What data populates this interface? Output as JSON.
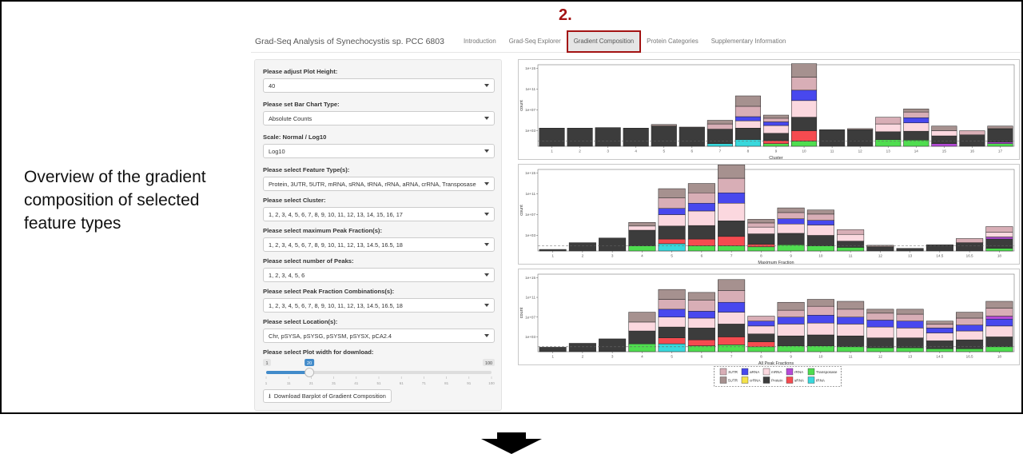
{
  "caption": "Overview  of the gradient composition of selected feature types",
  "step_number": "2.",
  "app": {
    "title": "Grad-Seq Analysis of Synechocystis sp. PCC 6803",
    "tabs": [
      {
        "label": "Introduction",
        "active": false
      },
      {
        "label": "Grad-Seq Explorer",
        "active": false
      },
      {
        "label": "Gradient Composition",
        "active": true
      },
      {
        "label": "Protein Categories",
        "active": false
      },
      {
        "label": "Supplementary Information",
        "active": false
      }
    ]
  },
  "sidebar": {
    "fields": [
      {
        "label": "Please adjust Plot Height:",
        "value": "40"
      },
      {
        "label": "Please set Bar Chart Type:",
        "value": "Absolute Counts"
      },
      {
        "label": "Scale: Normal / Log10",
        "value": "Log10"
      },
      {
        "label": "Please select Feature Type(s):",
        "value": "Protein, 3UTR, 5UTR, mRNA, sRNA, tRNA, rRNA, aRNA, crRNA, Transposase"
      },
      {
        "label": "Please select Cluster:",
        "value": "1, 2, 3, 4, 5, 6, 7, 8, 9, 10, 11, 12, 13, 14, 15, 16, 17"
      },
      {
        "label": "Please select maximum Peak Fraction(s):",
        "value": "1, 2, 3, 4, 5, 6, 7, 8, 9, 10, 11, 12, 13, 14.5, 16.5, 18"
      },
      {
        "label": "Please select number of Peaks:",
        "value": "1, 2, 3, 4, 5, 6"
      },
      {
        "label": "Please select Peak Fraction Combinations(s):",
        "value": "1, 2, 3, 4, 5, 6, 7, 8, 9, 10, 11, 12, 13, 14.5, 16.5, 18"
      },
      {
        "label": "Please select Location(s):",
        "value": "Chr, pSYSA, pSYSG, pSYSM, pSYSX, pCA2.4"
      }
    ],
    "slider": {
      "label": "Please select Plot width for download:",
      "min": 1,
      "max": 100,
      "value": 20,
      "min_label": "1",
      "max_label": "100",
      "value_label": "20",
      "ticks": [
        "1",
        "11",
        "21",
        "31",
        "41",
        "51",
        "61",
        "71",
        "81",
        "91",
        "100"
      ]
    },
    "download_button": "Download Barplot of Gradient Composition"
  },
  "colors": {
    "3UTR": "#d8aeb6",
    "5UTR": "#a6918f",
    "aRNA": "#4848ee",
    "crRNA": "#f4e24a",
    "mRNA": "#fbd8df",
    "Protein": "#3c3c3c",
    "rRNA": "#b54bd8",
    "sRNA": "#f54b50",
    "Transposase": "#4fdd4f",
    "tRNA": "#38d8dc"
  },
  "legend": [
    {
      "name": "3UTR",
      "color": "#d8aeb6"
    },
    {
      "name": "5UTR",
      "color": "#a6918f"
    },
    {
      "name": "aRNA",
      "color": "#4848ee"
    },
    {
      "name": "crRNA",
      "color": "#f4e24a"
    },
    {
      "name": "mRNA",
      "color": "#fbd8df"
    },
    {
      "name": "Protein",
      "color": "#3c3c3c"
    },
    {
      "name": "rRNA",
      "color": "#b54bd8"
    },
    {
      "name": "sRNA",
      "color": "#f54b50"
    },
    {
      "name": "Transposase",
      "color": "#4fdd4f"
    },
    {
      "name": "tRNA",
      "color": "#38d8dc"
    }
  ],
  "chart_data": [
    {
      "type": "bar",
      "xlabel": "Cluster",
      "ylabel": "count",
      "y_scale": "log10",
      "y_ticks": [
        "1e+03",
        "1e+07",
        "1e+11",
        "1e+15"
      ],
      "categories": [
        "1",
        "2",
        "3",
        "4",
        "5",
        "6",
        "7",
        "8",
        "9",
        "10",
        "11",
        "12",
        "13",
        "14",
        "15",
        "16",
        "17"
      ],
      "stacks": [
        [
          [
            "Protein",
            3.5
          ]
        ],
        [
          [
            "Protein",
            3.5
          ]
        ],
        [
          [
            "Protein",
            3.6
          ]
        ],
        [
          [
            "Protein",
            3.5
          ]
        ],
        [
          [
            "Protein",
            3.9
          ],
          [
            "5UTR",
            0.3
          ]
        ],
        [
          [
            "Protein",
            3.6
          ],
          [
            "5UTR",
            0.1
          ]
        ],
        [
          [
            "tRNA",
            0.5
          ],
          [
            "Protein",
            2.8
          ],
          [
            "3UTR",
            1.0
          ],
          [
            "5UTR",
            0.7
          ]
        ],
        [
          [
            "tRNA",
            1.3
          ],
          [
            "Protein",
            2.2
          ],
          [
            "mRNA",
            1.4
          ],
          [
            "aRNA",
            0.8
          ],
          [
            "3UTR",
            2.0
          ],
          [
            "5UTR",
            2.0
          ]
        ],
        [
          [
            "Transposase",
            0.5
          ],
          [
            "sRNA",
            0.6
          ],
          [
            "Protein",
            1.4
          ],
          [
            "mRNA",
            1.5
          ],
          [
            "aRNA",
            0.7
          ],
          [
            "3UTR",
            0.7
          ],
          [
            "5UTR",
            0.6
          ]
        ],
        [
          [
            "Transposase",
            1.0
          ],
          [
            "sRNA",
            2.0
          ],
          [
            "Protein",
            2.6
          ],
          [
            "mRNA",
            3.2
          ],
          [
            "aRNA",
            2.0
          ],
          [
            "3UTR",
            2.5
          ],
          [
            "5UTR",
            2.6
          ]
        ],
        [
          [
            "Protein",
            3.2
          ]
        ],
        [
          [
            "Protein",
            3.2
          ],
          [
            "5UTR",
            0.2
          ]
        ],
        [
          [
            "Transposase",
            1.3
          ],
          [
            "Protein",
            1.5
          ],
          [
            "mRNA",
            1.5
          ],
          [
            "3UTR",
            1.3
          ]
        ],
        [
          [
            "Transposase",
            1.2
          ],
          [
            "Protein",
            1.7
          ],
          [
            "mRNA",
            1.6
          ],
          [
            "aRNA",
            1.0
          ],
          [
            "3UTR",
            1.1
          ],
          [
            "5UTR",
            0.6
          ]
        ],
        [
          [
            "rRNA",
            0.5
          ],
          [
            "Protein",
            1.5
          ],
          [
            "mRNA",
            1.0
          ],
          [
            "5UTR",
            0.9
          ]
        ],
        [
          [
            "Protein",
            2.2
          ],
          [
            "3UTR",
            0.8
          ]
        ],
        [
          [
            "Transposase",
            0.5
          ],
          [
            "rRNA",
            0.3
          ],
          [
            "Protein",
            2.6
          ],
          [
            "5UTR",
            0.5
          ]
        ]
      ]
    },
    {
      "type": "bar",
      "xlabel": "Maximum Fraction",
      "ylabel": "count",
      "y_scale": "log10",
      "y_ticks": [
        "1e+03",
        "1e+07",
        "1e+11",
        "1e+15"
      ],
      "categories": [
        "1",
        "2",
        "3",
        "4",
        "5",
        "6",
        "7",
        "8",
        "9",
        "10",
        "11",
        "12",
        "13",
        "14.5",
        "16.5",
        "18"
      ],
      "stacks": [
        [
          [
            "Protein",
            0.3
          ]
        ],
        [
          [
            "Protein",
            1.6
          ]
        ],
        [
          [
            "Protein",
            2.5
          ]
        ],
        [
          [
            "Transposase",
            1.0
          ],
          [
            "Protein",
            3.0
          ],
          [
            "mRNA",
            0.8
          ],
          [
            "5UTR",
            0.7
          ]
        ],
        [
          [
            "tRNA",
            1.4
          ],
          [
            "sRNA",
            0.9
          ],
          [
            "Protein",
            2.5
          ],
          [
            "mRNA",
            2.2
          ],
          [
            "aRNA",
            1.2
          ],
          [
            "3UTR",
            2.0
          ],
          [
            "5UTR",
            1.8
          ]
        ],
        [
          [
            "Transposase",
            1.0
          ],
          [
            "sRNA",
            1.3
          ],
          [
            "Protein",
            2.6
          ],
          [
            "mRNA",
            2.8
          ],
          [
            "aRNA",
            1.5
          ],
          [
            "3UTR",
            2.0
          ],
          [
            "5UTR",
            1.8
          ]
        ],
        [
          [
            "Transposase",
            1.0
          ],
          [
            "sRNA",
            1.8
          ],
          [
            "Protein",
            3.0
          ],
          [
            "mRNA",
            3.4
          ],
          [
            "aRNA",
            2.0
          ],
          [
            "3UTR",
            2.8
          ],
          [
            "5UTR",
            2.6
          ]
        ],
        [
          [
            "Transposase",
            0.8
          ],
          [
            "sRNA",
            0.5
          ],
          [
            "Protein",
            2.0
          ],
          [
            "mRNA",
            1.3
          ],
          [
            "3UTR",
            0.8
          ],
          [
            "5UTR",
            0.7
          ]
        ],
        [
          [
            "Transposase",
            1.2
          ],
          [
            "Protein",
            2.2
          ],
          [
            "mRNA",
            1.8
          ],
          [
            "aRNA",
            1.0
          ],
          [
            "3UTR",
            1.2
          ],
          [
            "5UTR",
            0.9
          ]
        ],
        [
          [
            "Transposase",
            1.0
          ],
          [
            "Protein",
            2.0
          ],
          [
            "mRNA",
            2.0
          ],
          [
            "aRNA",
            0.9
          ],
          [
            "3UTR",
            1.2
          ],
          [
            "5UTR",
            0.8
          ]
        ],
        [
          [
            "Transposase",
            0.7
          ],
          [
            "Protein",
            1.2
          ],
          [
            "mRNA",
            1.3
          ],
          [
            "3UTR",
            0.9
          ]
        ],
        [
          [
            "Protein",
            0.8
          ],
          [
            "5UTR",
            0.3
          ]
        ],
        [
          [
            "Protein",
            0.5
          ]
        ],
        [
          [
            "Protein",
            1.2
          ]
        ],
        [
          [
            "Protein",
            1.6
          ],
          [
            "3UTR",
            0.8
          ]
        ],
        [
          [
            "Transposase",
            0.5
          ],
          [
            "Protein",
            1.8
          ],
          [
            "rRNA",
            0.4
          ],
          [
            "mRNA",
            0.9
          ],
          [
            "3UTR",
            1.1
          ]
        ]
      ]
    },
    {
      "type": "bar",
      "xlabel": "All Peak Fractions",
      "ylabel": "count",
      "y_scale": "log10",
      "y_ticks": [
        "1e+03",
        "1e+07",
        "1e+11",
        "1e+15"
      ],
      "categories": [
        "1",
        "2",
        "3",
        "4",
        "5",
        "6",
        "7",
        "8",
        "9",
        "10",
        "11",
        "12",
        "13",
        "14.5",
        "16.5",
        "18"
      ],
      "stacks": [
        [
          [
            "Protein",
            0.9
          ]
        ],
        [
          [
            "Protein",
            1.7
          ]
        ],
        [
          [
            "Protein",
            2.6
          ]
        ],
        [
          [
            "Transposase",
            1.6
          ],
          [
            "Protein",
            2.6
          ],
          [
            "mRNA",
            1.8
          ],
          [
            "5UTR",
            2.0
          ]
        ],
        [
          [
            "tRNA",
            1.6
          ],
          [
            "sRNA",
            1.2
          ],
          [
            "Protein",
            2.2
          ],
          [
            "mRNA",
            2.0
          ],
          [
            "aRNA",
            1.6
          ],
          [
            "3UTR",
            2.0
          ],
          [
            "5UTR",
            2.0
          ]
        ],
        [
          [
            "Transposase",
            1.2
          ],
          [
            "sRNA",
            1.2
          ],
          [
            "Protein",
            2.4
          ],
          [
            "mRNA",
            2.0
          ],
          [
            "aRNA",
            1.4
          ],
          [
            "3UTR",
            2.2
          ],
          [
            "5UTR",
            1.6
          ]
        ],
        [
          [
            "Transposase",
            1.4
          ],
          [
            "sRNA",
            1.6
          ],
          [
            "Protein",
            2.6
          ],
          [
            "mRNA",
            2.4
          ],
          [
            "aRNA",
            2.0
          ],
          [
            "3UTR",
            2.4
          ],
          [
            "5UTR",
            2.2
          ]
        ],
        [
          [
            "Transposase",
            1.0
          ],
          [
            "sRNA",
            1.0
          ],
          [
            "Protein",
            1.6
          ],
          [
            "mRNA",
            1.6
          ],
          [
            "aRNA",
            1.0
          ],
          [
            "3UTR",
            1.0
          ]
        ],
        [
          [
            "Transposase",
            1.2
          ],
          [
            "Protein",
            2.0
          ],
          [
            "mRNA",
            2.4
          ],
          [
            "aRNA",
            1.4
          ],
          [
            "3UTR",
            1.4
          ],
          [
            "5UTR",
            1.6
          ]
        ],
        [
          [
            "Transposase",
            1.2
          ],
          [
            "Protein",
            2.2
          ],
          [
            "mRNA",
            2.4
          ],
          [
            "aRNA",
            1.6
          ],
          [
            "3UTR",
            1.8
          ],
          [
            "5UTR",
            1.4
          ]
        ],
        [
          [
            "Transposase",
            1.0
          ],
          [
            "Protein",
            2.2
          ],
          [
            "mRNA",
            2.4
          ],
          [
            "aRNA",
            1.4
          ],
          [
            "3UTR",
            1.6
          ],
          [
            "5UTR",
            1.6
          ]
        ],
        [
          [
            "Transposase",
            0.8
          ],
          [
            "Protein",
            2.0
          ],
          [
            "mRNA",
            2.2
          ],
          [
            "aRNA",
            1.4
          ],
          [
            "3UTR",
            1.4
          ],
          [
            "5UTR",
            0.8
          ]
        ],
        [
          [
            "Transposase",
            0.8
          ],
          [
            "Protein",
            2.0
          ],
          [
            "mRNA",
            2.0
          ],
          [
            "aRNA",
            1.4
          ],
          [
            "3UTR",
            1.4
          ],
          [
            "5UTR",
            1.0
          ]
        ],
        [
          [
            "Transposase",
            0.6
          ],
          [
            "Protein",
            1.6
          ],
          [
            "mRNA",
            1.6
          ],
          [
            "aRNA",
            1.0
          ],
          [
            "3UTR",
            0.8
          ],
          [
            "5UTR",
            0.6
          ]
        ],
        [
          [
            "Transposase",
            0.6
          ],
          [
            "Protein",
            1.8
          ],
          [
            "mRNA",
            1.8
          ],
          [
            "aRNA",
            1.2
          ],
          [
            "3UTR",
            1.4
          ],
          [
            "5UTR",
            1.2
          ]
        ],
        [
          [
            "Transposase",
            1.0
          ],
          [
            "Protein",
            2.0
          ],
          [
            "mRNA",
            2.2
          ],
          [
            "aRNA",
            1.4
          ],
          [
            "rRNA",
            0.6
          ],
          [
            "3UTR",
            1.6
          ],
          [
            "5UTR",
            1.4
          ]
        ]
      ]
    }
  ]
}
